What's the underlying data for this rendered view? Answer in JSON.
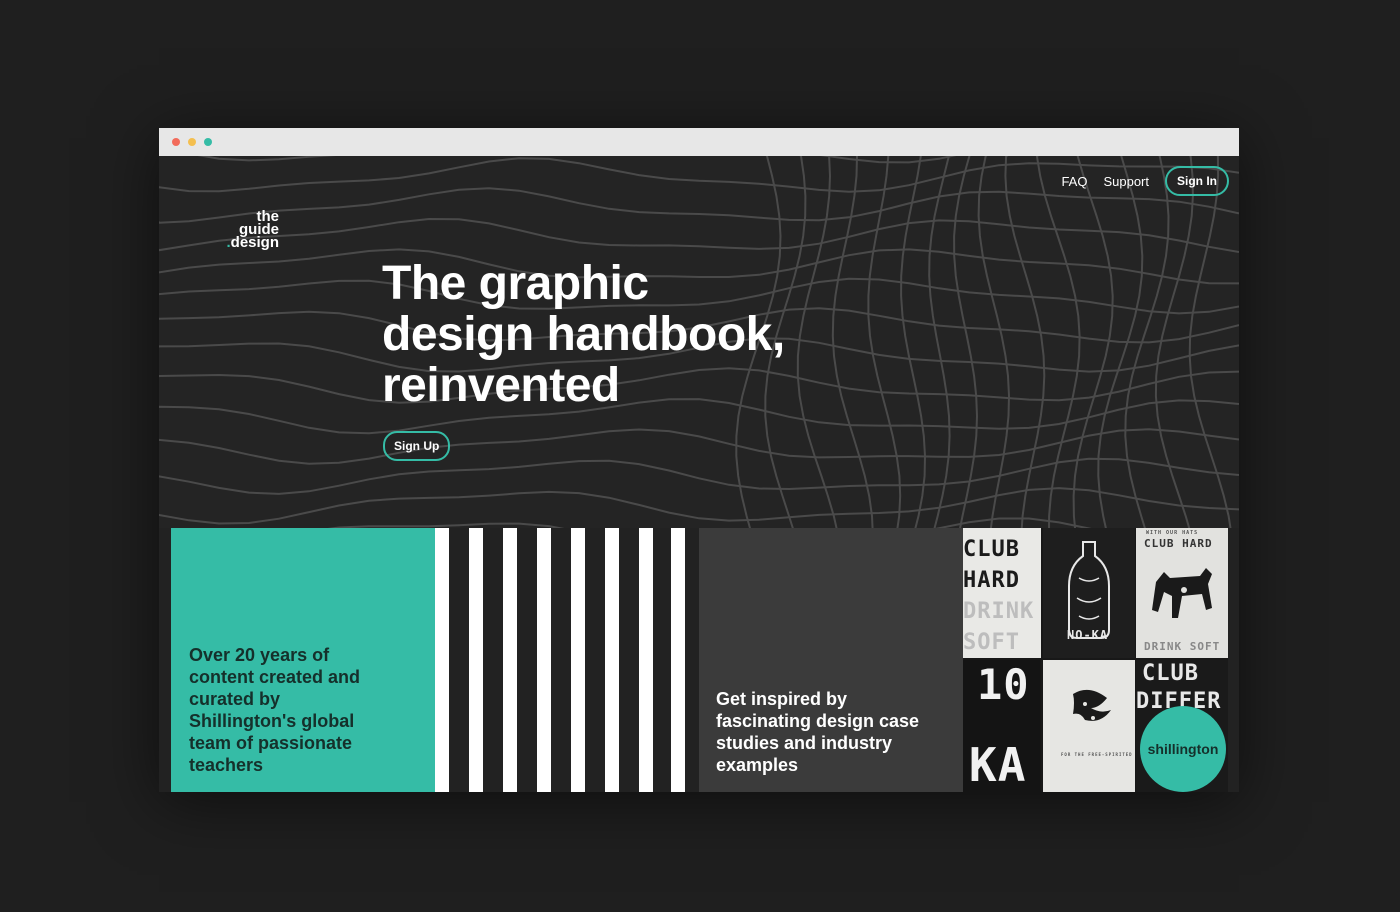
{
  "nav": {
    "faq": "FAQ",
    "support": "Support",
    "sign_in": "Sign In"
  },
  "logo": {
    "line1": "the",
    "line2": "guide",
    "line3": "design",
    "dot": "."
  },
  "hero": {
    "headline_line1": "The graphic",
    "headline_line2": "design handbook,",
    "headline_line3": "reinvented",
    "signup_label": "Sign Up"
  },
  "tiles": {
    "teal_text": "Over 20 years of content created and curated by Shillington's global team of passionate teachers",
    "gray_text": "Get inspired by fascinating design case studies and industry examples"
  },
  "posters": {
    "col1": [
      "CLUB",
      "HARD",
      "DRINK",
      "SOFT"
    ],
    "noka": "NO-KA",
    "top_right": "CLUB HARD",
    "bottom_right": "DRINK SOFT",
    "club": "CLUB",
    "differ": "DIFFER",
    "big_ka": "KA",
    "ten": "10",
    "small_caption": "WITH OUR HATS",
    "free_caption": "FOR THE FREE-SPIRITED",
    "badge": "shillington"
  },
  "colors": {
    "accent": "#35bca6",
    "background": "#1f1f1f",
    "hero_bg": "#242424"
  }
}
